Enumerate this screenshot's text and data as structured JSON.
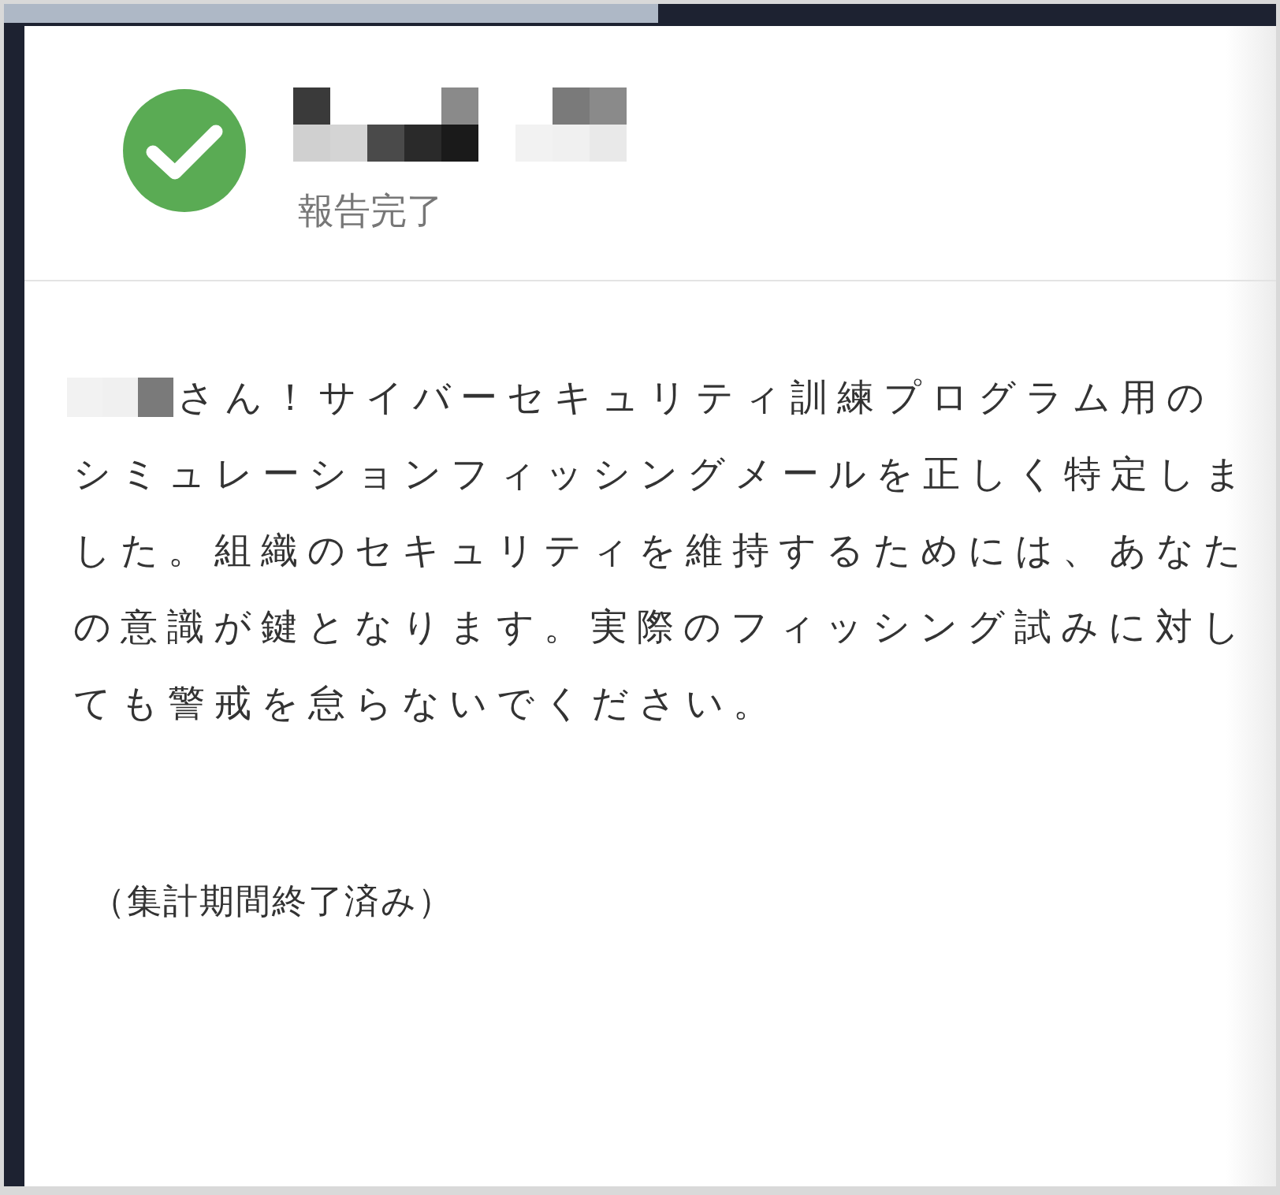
{
  "header": {
    "status": "報告完了"
  },
  "greeting": "さん！サイバーセキュリティ訓練プログラム用の",
  "message": "シミュレーションフィッシングメールを正しく特定しました。組織のセキュリティを維持するためには、あなたの意識が鍵となります。実際のフィッシング試みに対しても警戒を怠らないでください。",
  "note": "（集計期間終了済み）"
}
